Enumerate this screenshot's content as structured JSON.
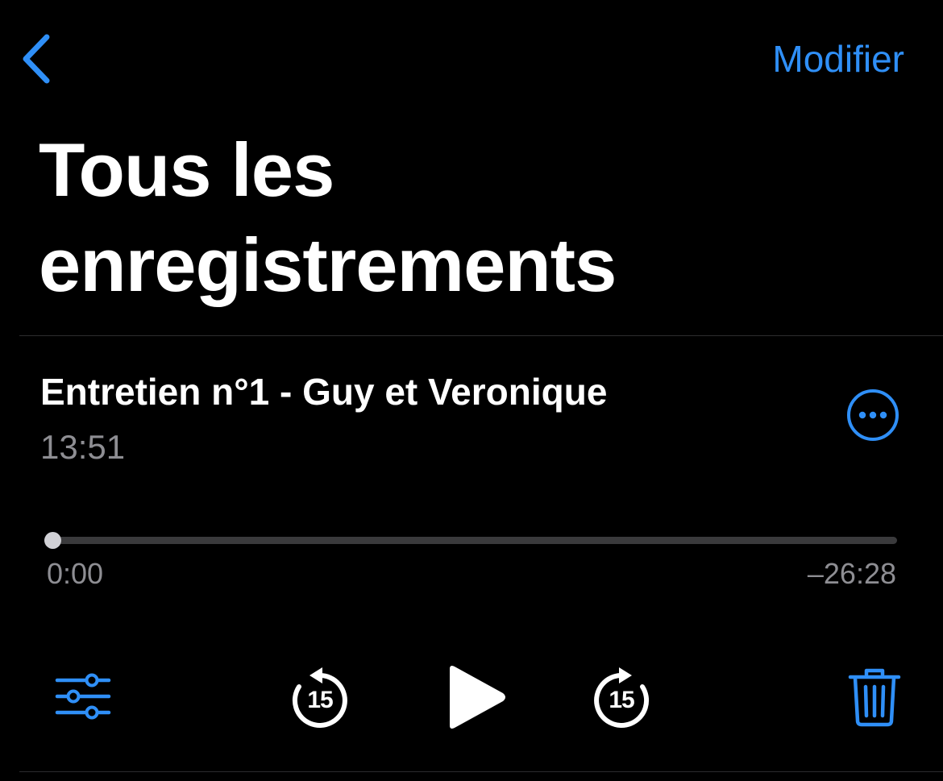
{
  "nav": {
    "back_icon": "chevron-left-icon",
    "edit_label": "Modifier"
  },
  "page": {
    "title": "Tous les enregistrements"
  },
  "recording": {
    "title": "Entretien n°1 - Guy et Veronique",
    "time": "13:51",
    "more_icon": "ellipsis-circle-icon"
  },
  "playback": {
    "elapsed": "0:00",
    "remaining": "–26:28",
    "progress_fraction": 0.0
  },
  "controls": {
    "options_icon": "sliders-icon",
    "rewind_icon": "rewind-15-icon",
    "rewind_seconds": "15",
    "play_icon": "play-icon",
    "forward_icon": "forward-15-icon",
    "forward_seconds": "15",
    "delete_icon": "trash-icon"
  },
  "colors": {
    "accent": "#2f8ff7",
    "background": "#000000",
    "secondary_text": "#8e8e93",
    "track": "#3a3a3c"
  }
}
